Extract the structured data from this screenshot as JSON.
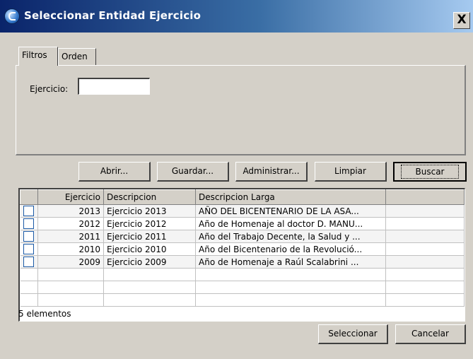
{
  "window": {
    "title": "Seleccionar Entidad Ejercicio",
    "close_glyph": "X"
  },
  "tabs": [
    {
      "label": "Filtros"
    },
    {
      "label": "Orden"
    }
  ],
  "filters": {
    "ejercicio_label": "Ejercicio:",
    "ejercicio_value": ""
  },
  "toolbar": {
    "abrir": "Abrir...",
    "guardar": "Guardar...",
    "administrar": "Administrar...",
    "limpiar": "Limpiar",
    "buscar": "Buscar"
  },
  "grid": {
    "columns": [
      "",
      "Ejercicio",
      "Descripcion",
      "Descripcion Larga",
      ""
    ],
    "rows": [
      {
        "ejercicio": "2013",
        "descripcion": "Ejercicio 2013",
        "larga": "AÑO DEL BICENTENARIO DE LA ASA..."
      },
      {
        "ejercicio": "2012",
        "descripcion": "Ejercicio 2012",
        "larga": "Año de Homenaje al doctor D. MANU..."
      },
      {
        "ejercicio": "2011",
        "descripcion": "Ejercicio 2011",
        "larga": "Año del Trabajo Decente, la Salud y ..."
      },
      {
        "ejercicio": "2010",
        "descripcion": "Ejercicio 2010",
        "larga": "Año del Bicentenario de la Revolució..."
      },
      {
        "ejercicio": "2009",
        "descripcion": "Ejercicio 2009",
        "larga": "Año de Homenaje a Raúl Scalabrini ..."
      }
    ],
    "count_text": "5 elementos"
  },
  "actions": {
    "seleccionar": "Seleccionar",
    "cancelar": "Cancelar"
  },
  "colors": {
    "titlebar_start": "#0a246a",
    "titlebar_end": "#a6caf0",
    "face": "#d4d0c8"
  }
}
